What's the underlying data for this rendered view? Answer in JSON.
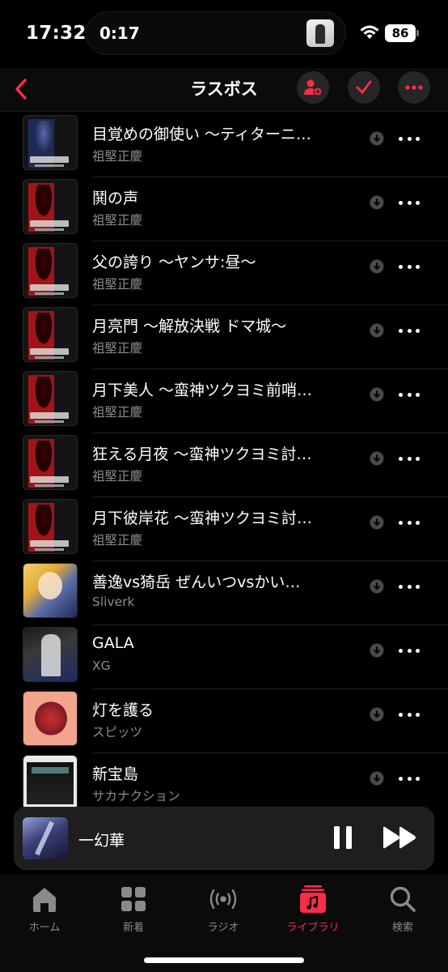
{
  "status_bar": {
    "time": "17:32",
    "activity_time": "0:17",
    "battery": "86"
  },
  "nav": {
    "title": "ラスボス",
    "accent_color": "#fa2d48"
  },
  "tracks": [
    {
      "title": "目覚めの御使い 〜ティターニ…",
      "artist": "祖堅正慶",
      "art": "ff-shadowbringers"
    },
    {
      "title": "鬨の声",
      "artist": "祖堅正慶",
      "art": "ff-stormblood"
    },
    {
      "title": "父の誇り 〜ヤンサ:昼〜",
      "artist": "祖堅正慶",
      "art": "ff-stormblood"
    },
    {
      "title": "月亮門 〜解放決戦 ドマ城〜",
      "artist": "祖堅正慶",
      "art": "ff-stormblood"
    },
    {
      "title": "月下美人 〜蛮神ツクヨミ前哨…",
      "artist": "祖堅正慶",
      "art": "ff-stormblood"
    },
    {
      "title": "狂える月夜 〜蛮神ツクヨミ討…",
      "artist": "祖堅正慶",
      "art": "ff-stormblood"
    },
    {
      "title": "月下彼岸花 〜蛮神ツクヨミ討…",
      "artist": "祖堅正慶",
      "art": "ff-stormblood"
    },
    {
      "title": "善逸vs猗岳 ぜんいつvsかい…",
      "artist": "Sliverk",
      "art": "anime"
    },
    {
      "title": "GALA",
      "artist": "XG",
      "art": "xg"
    },
    {
      "title": "灯を護る",
      "artist": "スピッツ",
      "art": "spitz"
    },
    {
      "title": "新宝島",
      "artist": "サカナクション",
      "art": "sakanaction"
    }
  ],
  "mini_player": {
    "title": "一幻華"
  },
  "tab_bar": {
    "home": "ホーム",
    "new": "新着",
    "radio": "ラジオ",
    "library": "ライブラリ",
    "search": "検索"
  }
}
